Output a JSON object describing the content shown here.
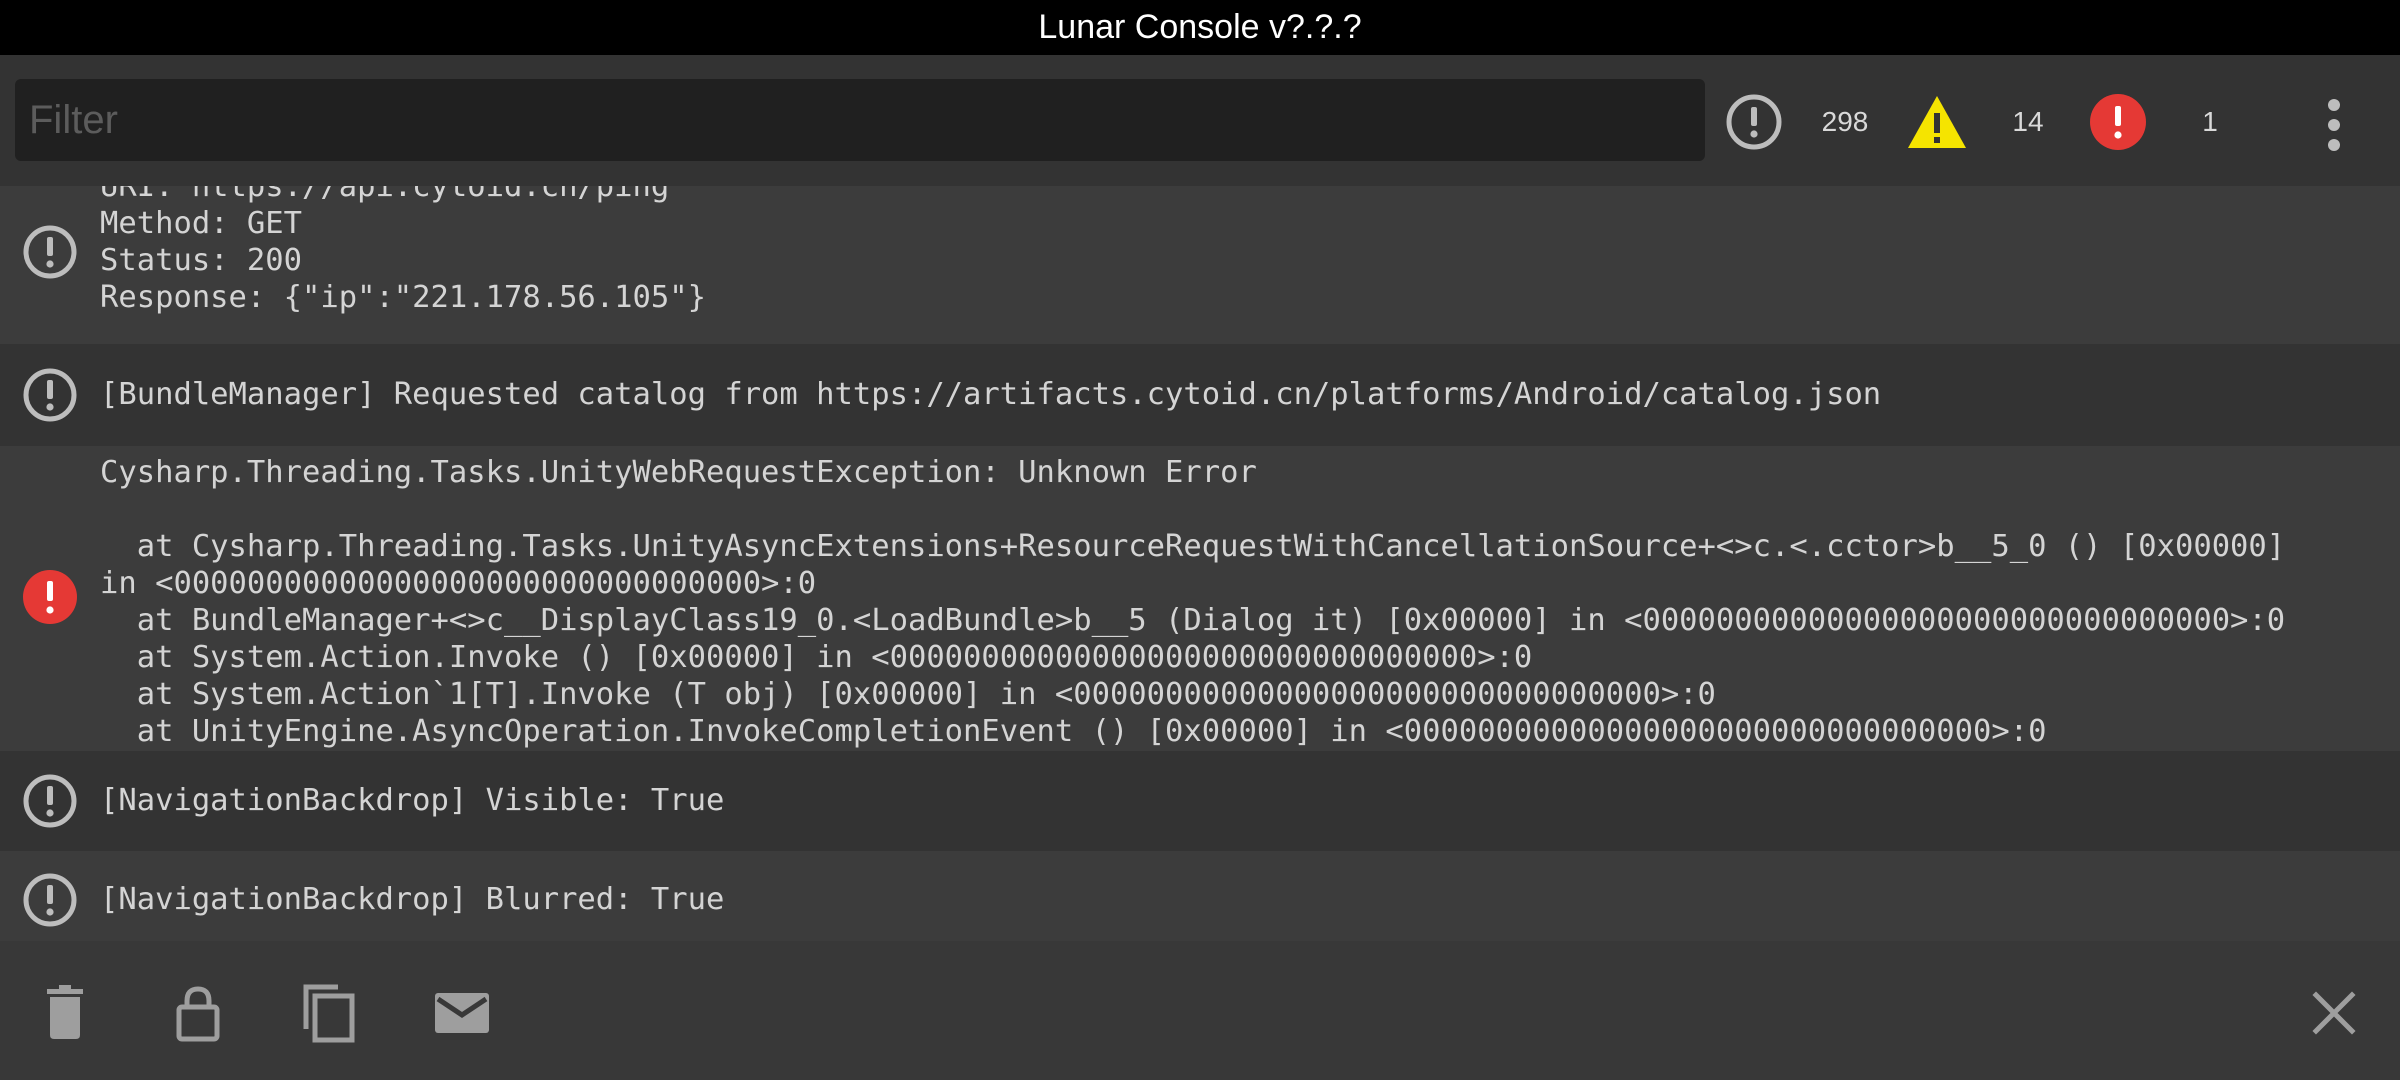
{
  "app": {
    "title": "Lunar Console v?.?.?"
  },
  "filter": {
    "placeholder": "Filter",
    "value": ""
  },
  "counters": {
    "log": {
      "icon": "info-icon",
      "count": "298"
    },
    "warning": {
      "icon": "warning-icon",
      "count": "14"
    },
    "error": {
      "icon": "error-icon",
      "count": "1"
    }
  },
  "colors": {
    "log_icon": "#bdbdbd",
    "warning_icon": "#f5e400",
    "error_icon": "#e53935",
    "background": "#383838",
    "title_bar": "#000000"
  },
  "entries": [
    {
      "level": "log",
      "text": "URI: https://api.cytoid.cn/ping\nMethod: GET\nStatus: 200\nResponse: {\"ip\":\"221.178.56.105\"}"
    },
    {
      "level": "log",
      "text": "[BundleManager] Requested catalog from https://artifacts.cytoid.cn/platforms/Android/catalog.json"
    },
    {
      "level": "error",
      "text": "Cysharp.Threading.Tasks.UnityWebRequestException: Unknown Error\n\n  at Cysharp.Threading.Tasks.UnityAsyncExtensions+ResourceRequestWithCancellationSource+<>c.<.cctor>b__5_0 () [0x00000]\nin <00000000000000000000000000000000>:0\n  at BundleManager+<>c__DisplayClass19_0.<LoadBundle>b__5 (Dialog it) [0x00000] in <00000000000000000000000000000000>:0\n  at System.Action.Invoke () [0x00000] in <00000000000000000000000000000000>:0\n  at System.Action`1[T].Invoke (T obj) [0x00000] in <00000000000000000000000000000000>:0\n  at UnityEngine.AsyncOperation.InvokeCompletionEvent () [0x00000] in <00000000000000000000000000000000>:0"
    },
    {
      "level": "log",
      "text": "[NavigationBackdrop] Visible: True"
    },
    {
      "level": "log",
      "text": "[NavigationBackdrop] Blurred: True"
    }
  ],
  "bottom_bar": {
    "clear": "trash-icon",
    "lock": "lock-icon",
    "copy": "copy-icon",
    "email": "email-icon",
    "close": "close-icon"
  }
}
